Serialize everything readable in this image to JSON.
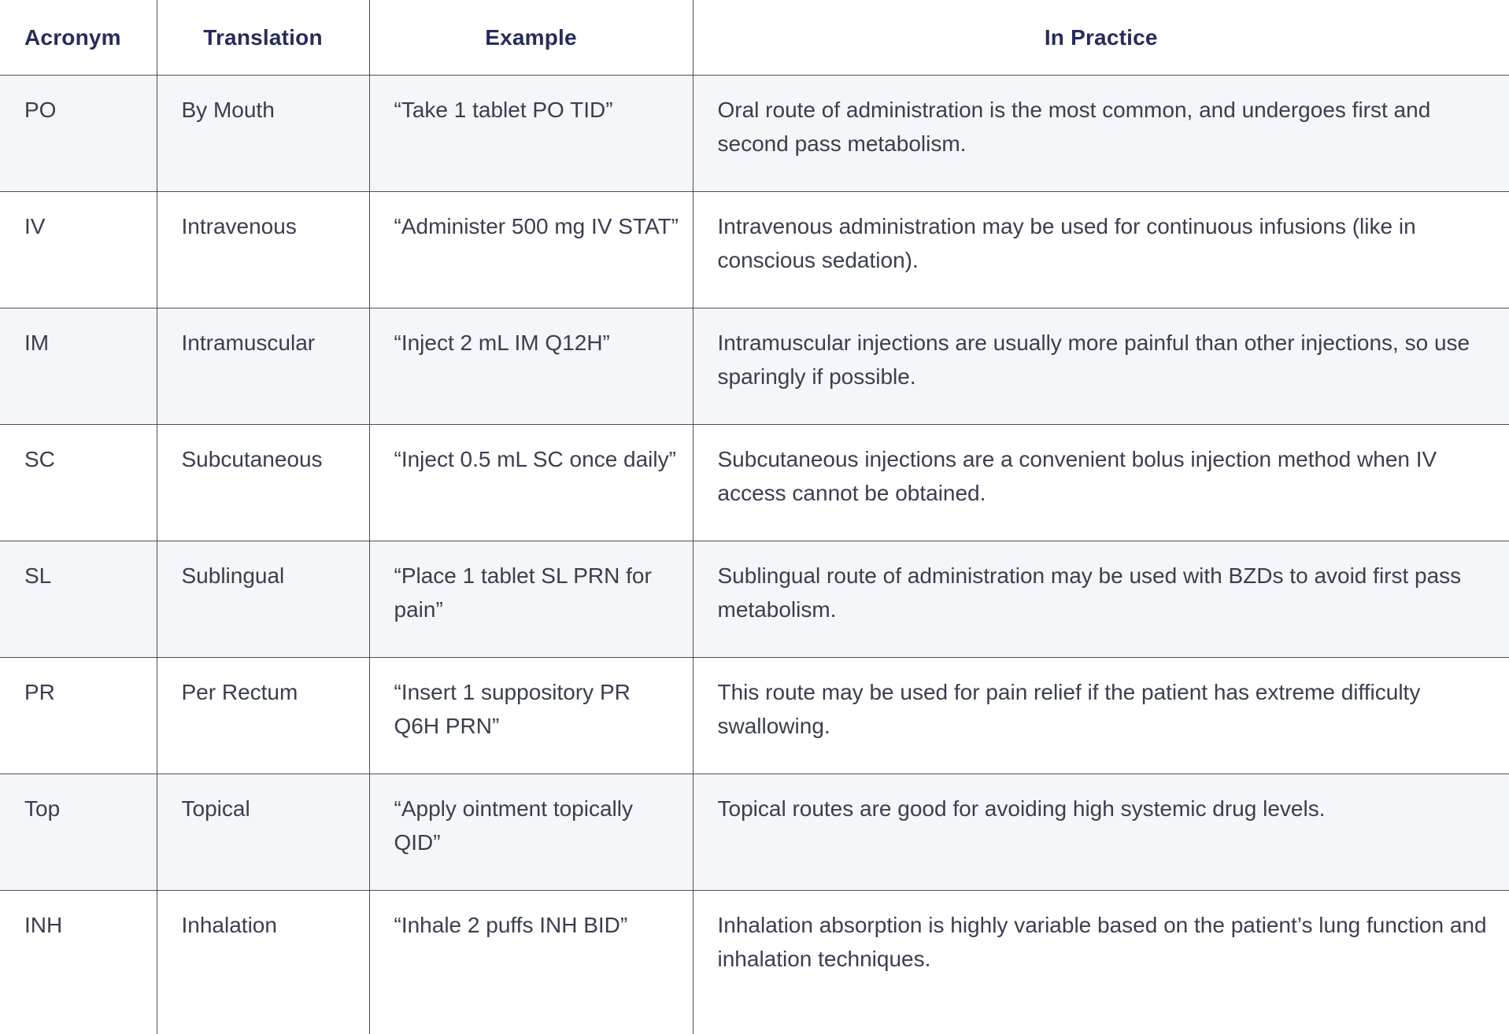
{
  "table": {
    "headers": [
      "Acronym",
      "Translation",
      "Example",
      "In Practice"
    ],
    "rows": [
      {
        "acronym": "PO",
        "translation": "By Mouth",
        "example": "“Take 1 tablet PO TID”",
        "in_practice": "Oral route of administration is the most common, and undergoes first and second pass metabolism."
      },
      {
        "acronym": "IV",
        "translation": "Intravenous",
        "example": "“Administer 500 mg IV STAT”",
        "in_practice": "Intravenous administration may be used for continuous infusions (like in conscious sedation)."
      },
      {
        "acronym": "IM",
        "translation": "Intramuscular",
        "example": "“Inject 2 mL IM Q12H”",
        "in_practice": "Intramuscular injections are usually more painful than other injections, so use sparingly if possible."
      },
      {
        "acronym": "SC",
        "translation": "Subcutaneous",
        "example": "“Inject 0.5 mL SC once daily”",
        "in_practice": "Subcutaneous injections are a convenient bolus injection method when IV access cannot be obtained."
      },
      {
        "acronym": "SL",
        "translation": "Sublingual",
        "example": "“Place 1 tablet SL PRN for pain”",
        "in_practice": "Sublingual route of administration may be used with BZDs to avoid first pass metabolism."
      },
      {
        "acronym": "PR",
        "translation": "Per Rectum",
        "example": "“Insert 1 suppository PR Q6H PRN”",
        "in_practice": "This route may be used for pain relief if the patient has extreme difficulty swallowing."
      },
      {
        "acronym": "Top",
        "translation": "Topical",
        "example": "“Apply ointment topically QID”",
        "in_practice": "Topical routes are good for avoiding high systemic drug levels."
      },
      {
        "acronym": "INH",
        "translation": "Inhalation",
        "example": "“Inhale 2 puffs INH BID”",
        "in_practice": "Inhalation absorption is highly variable based on the patient’s lung function and inhalation techniques."
      }
    ]
  },
  "colors": {
    "header_text": "#262c5c",
    "body_text": "#3a3e4e",
    "alt_row_bg": "#f5f6f9",
    "grid_line": "#4d4f57"
  }
}
